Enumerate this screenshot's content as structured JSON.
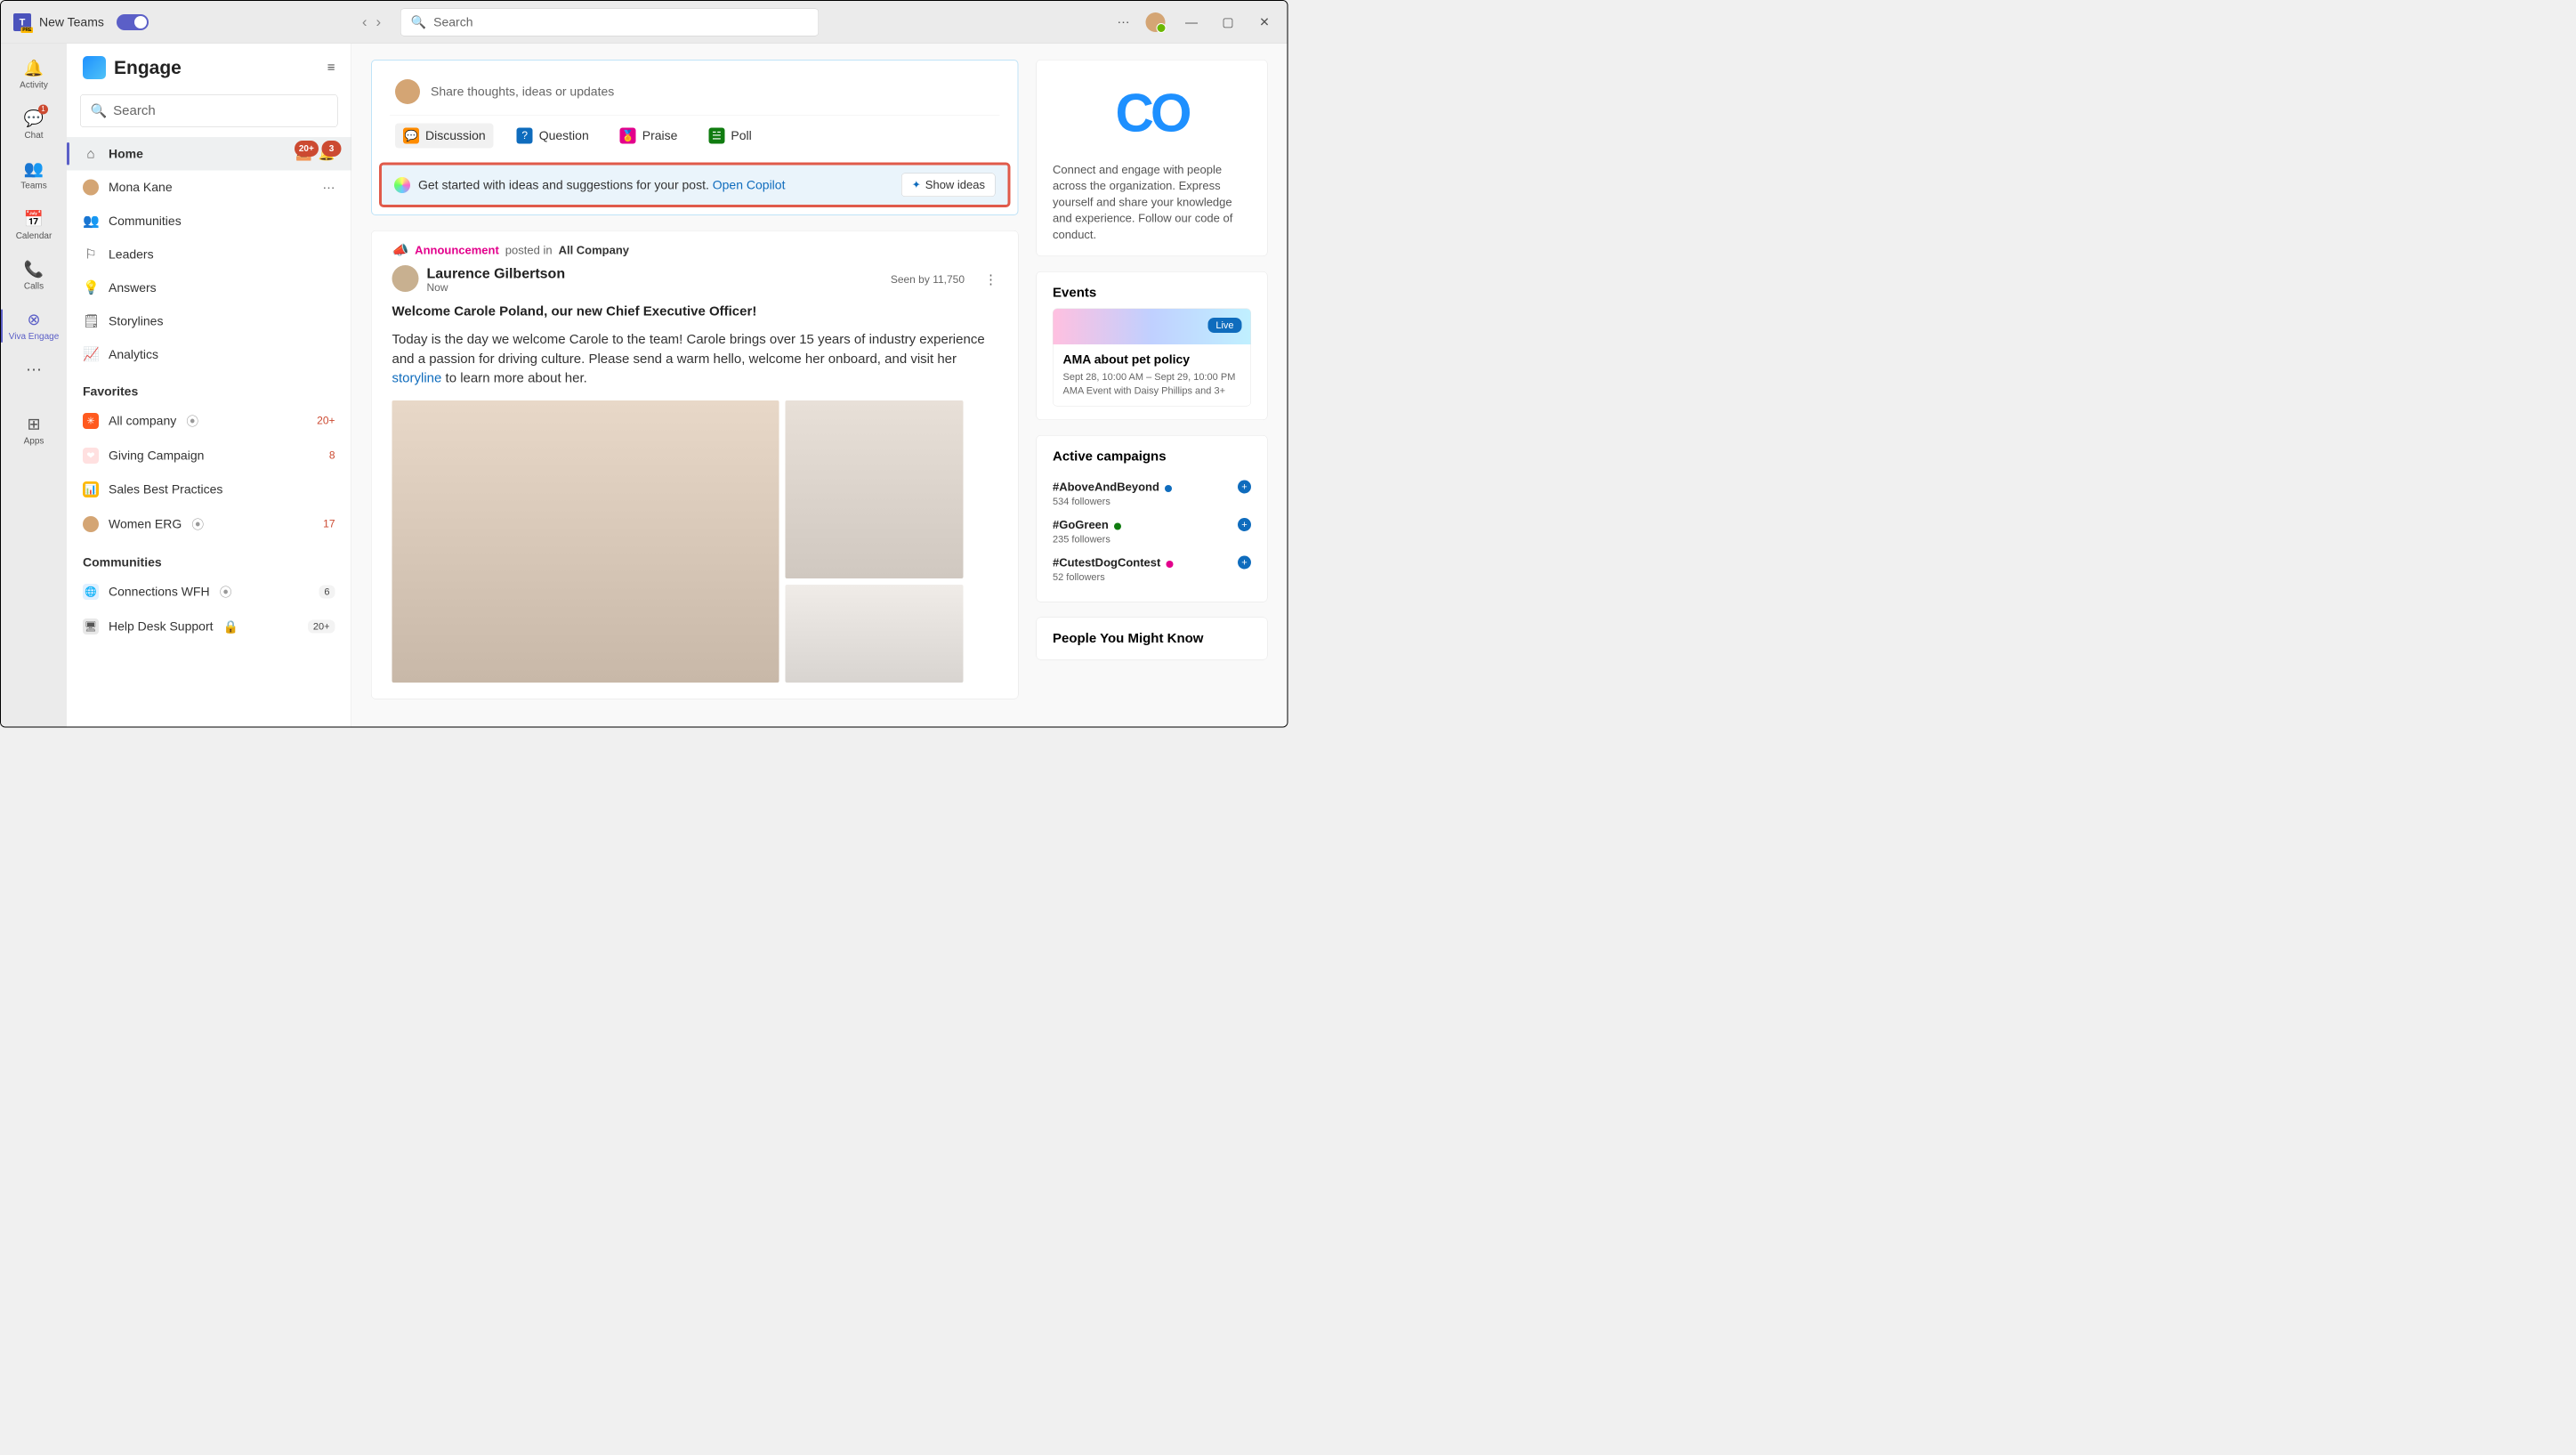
{
  "titlebar": {
    "app_name": "New Teams",
    "search_placeholder": "Search"
  },
  "rail": {
    "activity": "Activity",
    "chat": "Chat",
    "chat_badge": "1",
    "teams": "Teams",
    "calendar": "Calendar",
    "calls": "Calls",
    "engage": "Viva Engage",
    "apps": "Apps"
  },
  "engage": {
    "title": "Engage",
    "search_placeholder": "Search",
    "nav": {
      "home": "Home",
      "home_inbox_badge": "20+",
      "home_bell_badge": "3",
      "user": "Mona Kane",
      "communities": "Communities",
      "leaders": "Leaders",
      "answers": "Answers",
      "storylines": "Storylines",
      "analytics": "Analytics"
    },
    "favorites": {
      "header": "Favorites",
      "items": [
        {
          "name": "All company",
          "count": "20+",
          "color": "#ff5a1f",
          "emoji": "✳"
        },
        {
          "name": "Giving Campaign",
          "count": "8",
          "color": "#ffe0e0",
          "emoji": "❤"
        },
        {
          "name": "Sales Best Practices",
          "count": "",
          "color": "#ffb900",
          "emoji": "📊"
        },
        {
          "name": "Women ERG",
          "count": "17",
          "color": "#d4a574",
          "emoji": ""
        }
      ]
    },
    "communities": {
      "header": "Communities",
      "items": [
        {
          "name": "Connections WFH",
          "count": "6",
          "color": "#e0f0ff",
          "emoji": "🌐"
        },
        {
          "name": "Help Desk Support",
          "count": "20+",
          "color": "#e8e8e8",
          "emoji": "🖥"
        }
      ]
    }
  },
  "composer": {
    "placeholder": "Share thoughts, ideas or updates",
    "tabs": {
      "discussion": "Discussion",
      "question": "Question",
      "praise": "Praise",
      "poll": "Poll"
    }
  },
  "copilot": {
    "text": "Get started with ideas and suggestions for your post. ",
    "link": "Open Copilot",
    "button": "Show ideas"
  },
  "post": {
    "announcement_label": "Announcement",
    "posted_in": "posted in",
    "community": "All Company",
    "author": "Laurence Gilbertson",
    "time": "Now",
    "seen_by": "Seen by 11,750",
    "title": "Welcome Carole Poland, our new Chief Executive Officer!",
    "body_1": "Today is the day we welcome Carole to the team! Carole brings over 15 years of industry experience and a passion for driving culture. Please send a warm hello, welcome her onboard, and visit her ",
    "body_link": "storyline",
    "body_2": " to learn more about her."
  },
  "right": {
    "connect": "Connect and engage with people across the organization. Express yourself and share your knowledge and experience. Follow our code of conduct.",
    "events_title": "Events",
    "event": {
      "live": "Live",
      "title": "AMA about pet policy",
      "date": "Sept 28, 10:00 AM – Sept 29, 10:00 PM",
      "meta": "AMA Event with Daisy Phillips and 3+"
    },
    "campaigns_title": "Active campaigns",
    "campaigns": [
      {
        "tag": "#AboveAndBeyond",
        "followers": "534 followers",
        "vcolor": "#0f6cbd"
      },
      {
        "tag": "#GoGreen",
        "followers": "235 followers",
        "vcolor": "#107c10"
      },
      {
        "tag": "#CutestDogContest",
        "followers": "52 followers",
        "vcolor": "#e3008c"
      }
    ],
    "pymk_title": "People You Might Know"
  }
}
